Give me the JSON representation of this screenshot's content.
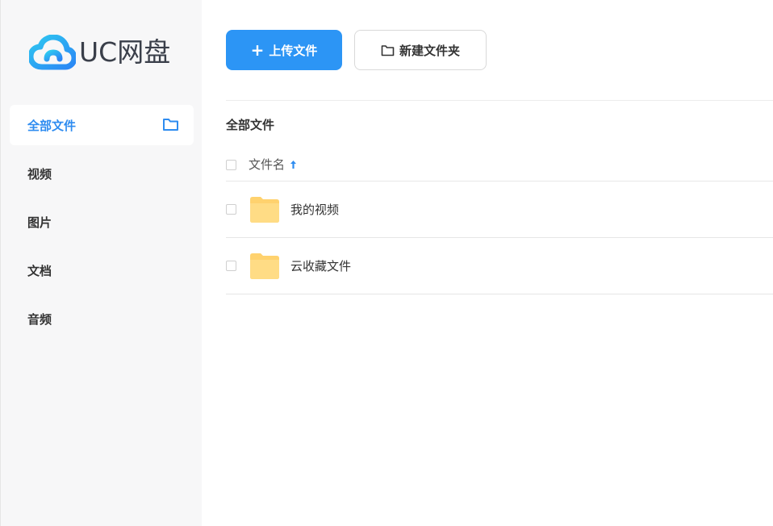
{
  "brand": {
    "logo_text": "UC网盘",
    "colors": {
      "accent": "#2c95f5",
      "cloud_gradient_start": "#2fc8f0",
      "cloud_gradient_end": "#2a86f5"
    }
  },
  "sidebar": {
    "items": [
      {
        "label": "全部文件",
        "icon": "folder-icon",
        "active": true
      },
      {
        "label": "视频",
        "active": false
      },
      {
        "label": "图片",
        "active": false
      },
      {
        "label": "文档",
        "active": false
      },
      {
        "label": "音频",
        "active": false
      }
    ]
  },
  "toolbar": {
    "upload_label": "上传文件",
    "upload_icon": "plus-icon",
    "new_folder_label": "新建文件夹",
    "new_folder_icon": "folder-outline-icon"
  },
  "breadcrumb": {
    "current": "全部文件"
  },
  "file_list": {
    "columns": [
      {
        "label": "文件名",
        "sort": "ascending",
        "sort_icon": "arrow-up-icon"
      }
    ],
    "rows": [
      {
        "name": "我的视频",
        "type": "folder",
        "icon": "folder-icon"
      },
      {
        "name": "云收藏文件",
        "type": "folder",
        "icon": "folder-icon"
      }
    ],
    "folder_color": "#ffd26e"
  }
}
